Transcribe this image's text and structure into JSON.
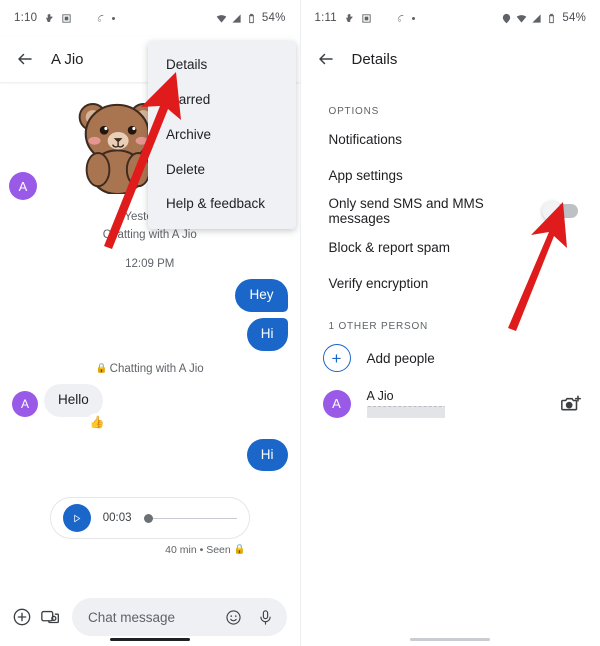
{
  "left_phone": {
    "status_bar": {
      "time": "1:10",
      "battery_percent": "54%",
      "left_icons": [
        "hand-icon",
        "screenshot-icon",
        "crescent-moon-icon",
        "swirl-icon",
        "dot-icon"
      ],
      "right_icons": [
        "wifi-icon",
        "signal-icon",
        "battery-icon"
      ]
    },
    "app_bar": {
      "back": "back-arrow-icon",
      "title": "A Jio"
    },
    "overflow_menu": {
      "items": [
        "Details",
        "Starred",
        "Archive",
        "Delete",
        "Help & feedback"
      ]
    },
    "conversation": {
      "sticker": "bear-sticker",
      "avatar_initial": "A",
      "day_divider": "Yesterday",
      "chatting_note_1": "Chatting with A Jio",
      "timestamp": "12:09 PM",
      "messages": [
        {
          "text": "Hey",
          "side": "out"
        },
        {
          "text": "Hi",
          "side": "out"
        }
      ],
      "encrypted_note": "Chatting with A Jio",
      "incoming": {
        "text": "Hello",
        "reaction": "👍"
      },
      "reply": {
        "text": "Hi",
        "side": "out"
      },
      "audio": {
        "duration": "00:03",
        "meta": "40 min • Seen",
        "play_icon": "play-icon"
      }
    },
    "composer": {
      "plus_icon": "plus-circle-icon",
      "gallery_icon": "gallery-camera-icon",
      "placeholder": "Chat message",
      "emoji_icon": "emoji-icon",
      "mic_icon": "microphone-icon"
    }
  },
  "right_phone": {
    "status_bar": {
      "time": "1:11",
      "battery_percent": "54%",
      "left_icons": [
        "hand-icon",
        "screenshot-icon",
        "crescent-moon-icon",
        "swirl-icon",
        "dot-icon"
      ],
      "right_icons": [
        "location-icon",
        "wifi-icon",
        "signal-icon",
        "battery-icon"
      ]
    },
    "app_bar": {
      "back": "back-arrow-icon",
      "title": "Details"
    },
    "options_label": "OPTIONS",
    "options": [
      {
        "label": "Notifications",
        "toggle": null
      },
      {
        "label": "App settings",
        "toggle": null
      },
      {
        "label": "Only send SMS and MMS messages",
        "toggle": "off"
      },
      {
        "label": "Block & report spam",
        "toggle": null
      },
      {
        "label": "Verify encryption",
        "toggle": null
      }
    ],
    "people_label": "1 OTHER PERSON",
    "add_people": "Add people",
    "person": {
      "initial": "A",
      "name": "A Jio",
      "number_hidden": true
    },
    "camera_icon": "add-photo-icon"
  },
  "annotations": {
    "arrow_color": "#e01b1b",
    "arrow_1_target": "Details",
    "arrow_2_target": "Only send SMS and MMS messages toggle"
  }
}
